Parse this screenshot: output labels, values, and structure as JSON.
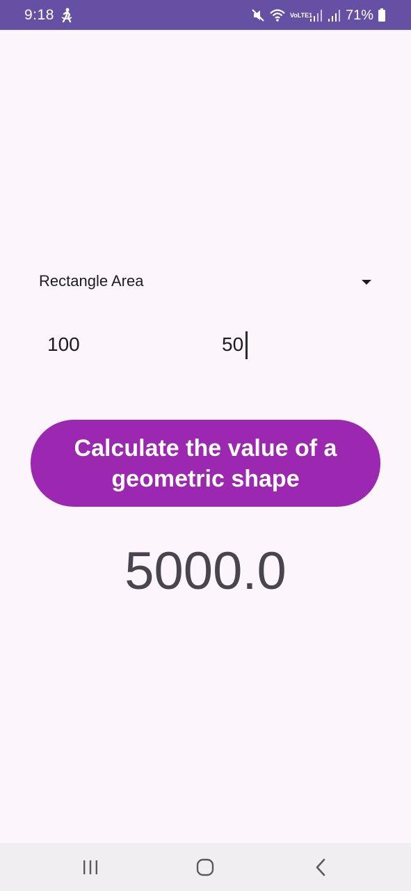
{
  "status_bar": {
    "time": "9:18",
    "network_label": "VoLTE1",
    "battery_percent": "71%",
    "background_color": "#6650a4",
    "icons": [
      "person-walk-icon",
      "mute-icon",
      "wifi-icon",
      "signal-icon",
      "signal-icon",
      "battery-icon"
    ]
  },
  "form": {
    "shape_dropdown": {
      "selected": "Rectangle Area"
    },
    "input_one": {
      "value": "100"
    },
    "input_two": {
      "value": "50"
    },
    "calculate_button_label": "Calculate the value of a geometric shape",
    "button_color": "#9c27b0"
  },
  "result": {
    "value": "5000.0"
  },
  "nav_bar": {
    "icons": [
      "recents-icon",
      "home-icon",
      "back-icon"
    ]
  }
}
